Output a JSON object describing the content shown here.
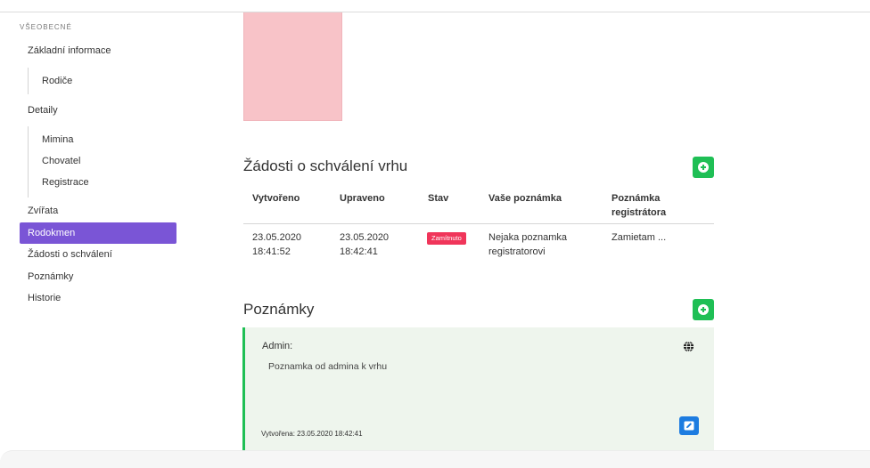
{
  "sidebar": {
    "heading": "VŠEOBECNÉ",
    "items": [
      {
        "label": "Základní informace"
      },
      {
        "label": "Rodiče"
      },
      {
        "label": "Detaily"
      },
      {
        "label": "Mimina"
      },
      {
        "label": "Chovatel"
      },
      {
        "label": "Registrace"
      },
      {
        "label": "Zvířata"
      },
      {
        "label": "Rodokmen"
      },
      {
        "label": "Žádosti o schválení"
      },
      {
        "label": "Poznámky"
      },
      {
        "label": "Historie"
      }
    ]
  },
  "requests": {
    "title": "Žádosti o schválení vrhu",
    "headers": [
      "Vytvořeno",
      "Upraveno",
      "Stav",
      "Vaše poznámka",
      "Poznámka",
      "registrátora"
    ],
    "row": {
      "created_date": "23.05.2020",
      "created_time": "18:41:52",
      "updated_date": "23.05.2020",
      "updated_time": "18:42:41",
      "status": "Zamítnuto",
      "note_line1": "Nejaka poznamka",
      "note_line2": "registratorovi",
      "registrar_note": "Zamietam ..."
    }
  },
  "notes": {
    "title": "Poznámky",
    "card": {
      "author": "Admin:",
      "text": "Poznamka od admina k vrhu",
      "created": "Vytvořena: 23.05.2020 18:42:41"
    }
  },
  "colors": {
    "accent_purple": "#7a55d6",
    "add_green": "#1fbf55",
    "status_red": "#f0355a",
    "edit_blue": "#1d7ce0",
    "image_pink": "#f8c3c8"
  },
  "icons": [
    "plus-circle-icon",
    "globe-icon",
    "edit-icon"
  ]
}
